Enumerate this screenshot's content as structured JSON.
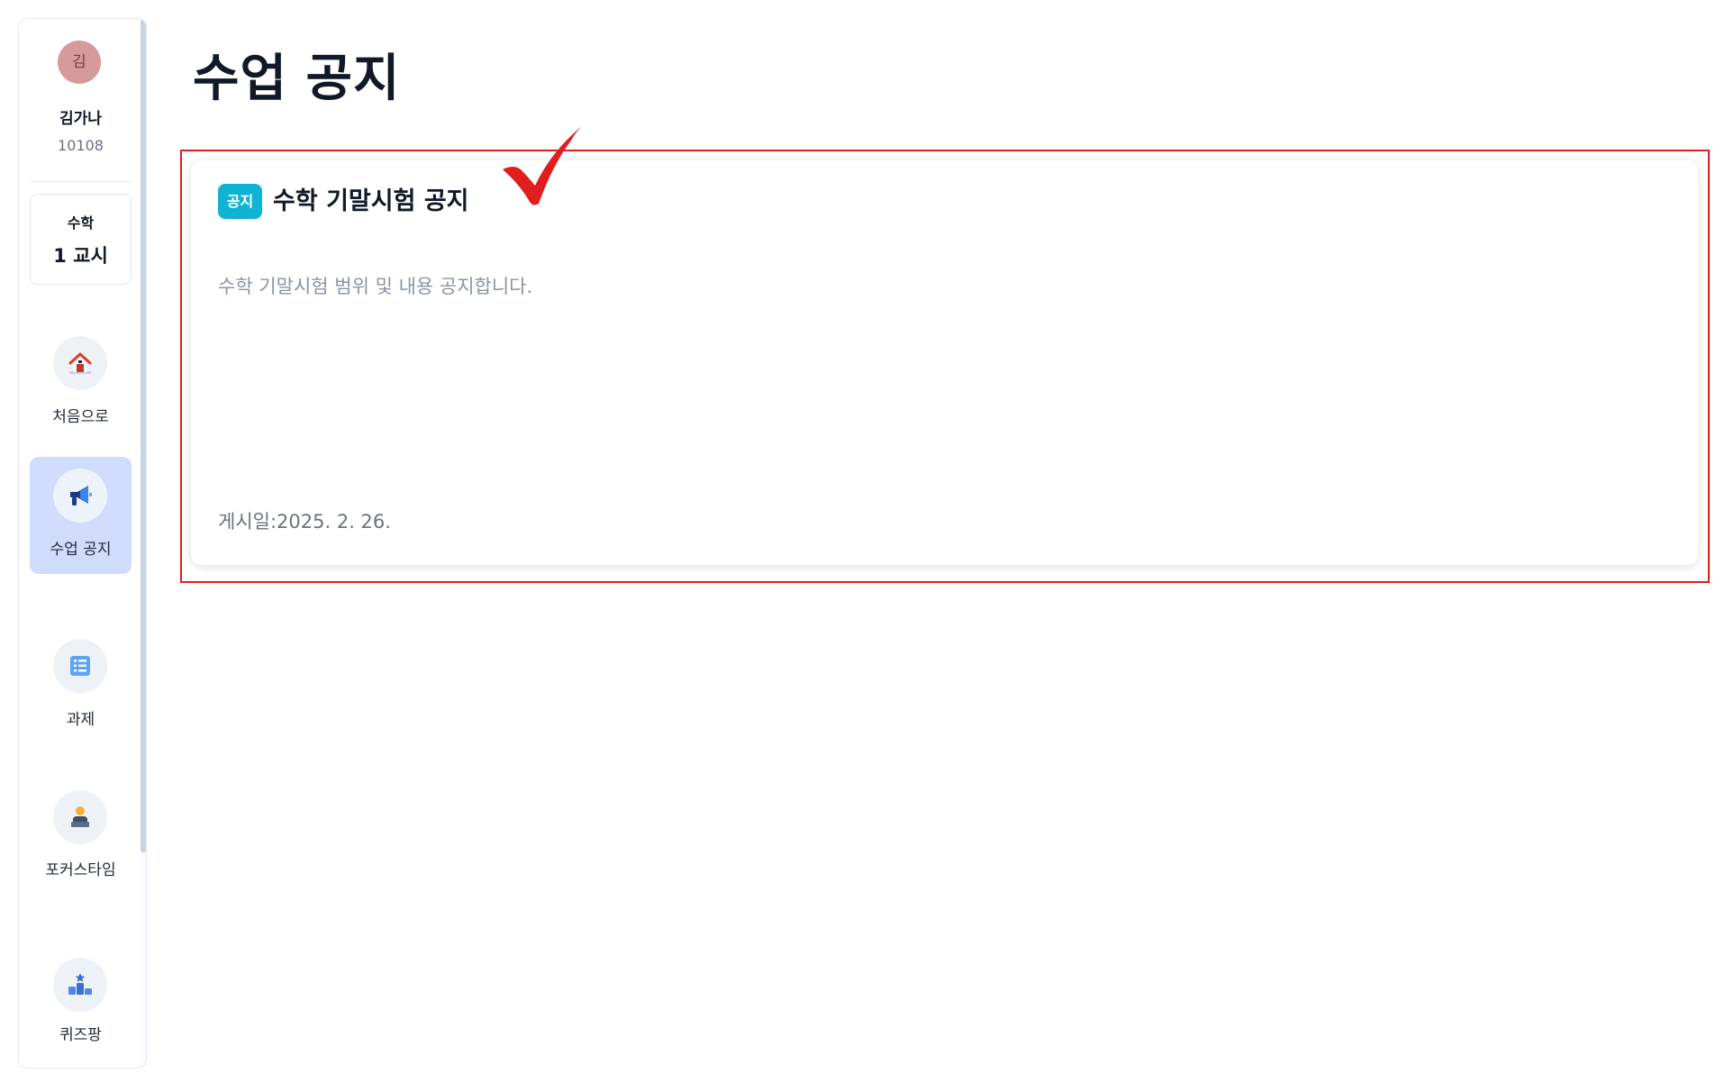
{
  "profile": {
    "avatar_initial": "김",
    "name": "김가나",
    "student_id": "10108"
  },
  "class_info": {
    "subject": "수학",
    "period": "1 교시"
  },
  "nav": {
    "items": [
      {
        "label": "처음으로",
        "icon": "home-icon",
        "active": false
      },
      {
        "label": "수업 공지",
        "icon": "megaphone-icon",
        "active": true
      },
      {
        "label": "과제",
        "icon": "list-icon",
        "active": false
      },
      {
        "label": "포커스타임",
        "icon": "focus-person-icon",
        "active": false
      },
      {
        "label": "퀴즈팡",
        "icon": "podium-icon",
        "active": false
      }
    ]
  },
  "main": {
    "title": "수업 공지"
  },
  "notice": {
    "badge": "공지",
    "title": "수학 기말시험 공지",
    "body": "수학 기말시험 범위 및 내용 공지합니다.",
    "date": "게시일:2025. 2. 26."
  },
  "colors": {
    "accent_badge": "#0fb3d4",
    "active_nav": "#cfdcfb",
    "highlight_frame": "#e11d1d",
    "check_mark": "#e11d1d",
    "avatar": "#d69a9a"
  }
}
